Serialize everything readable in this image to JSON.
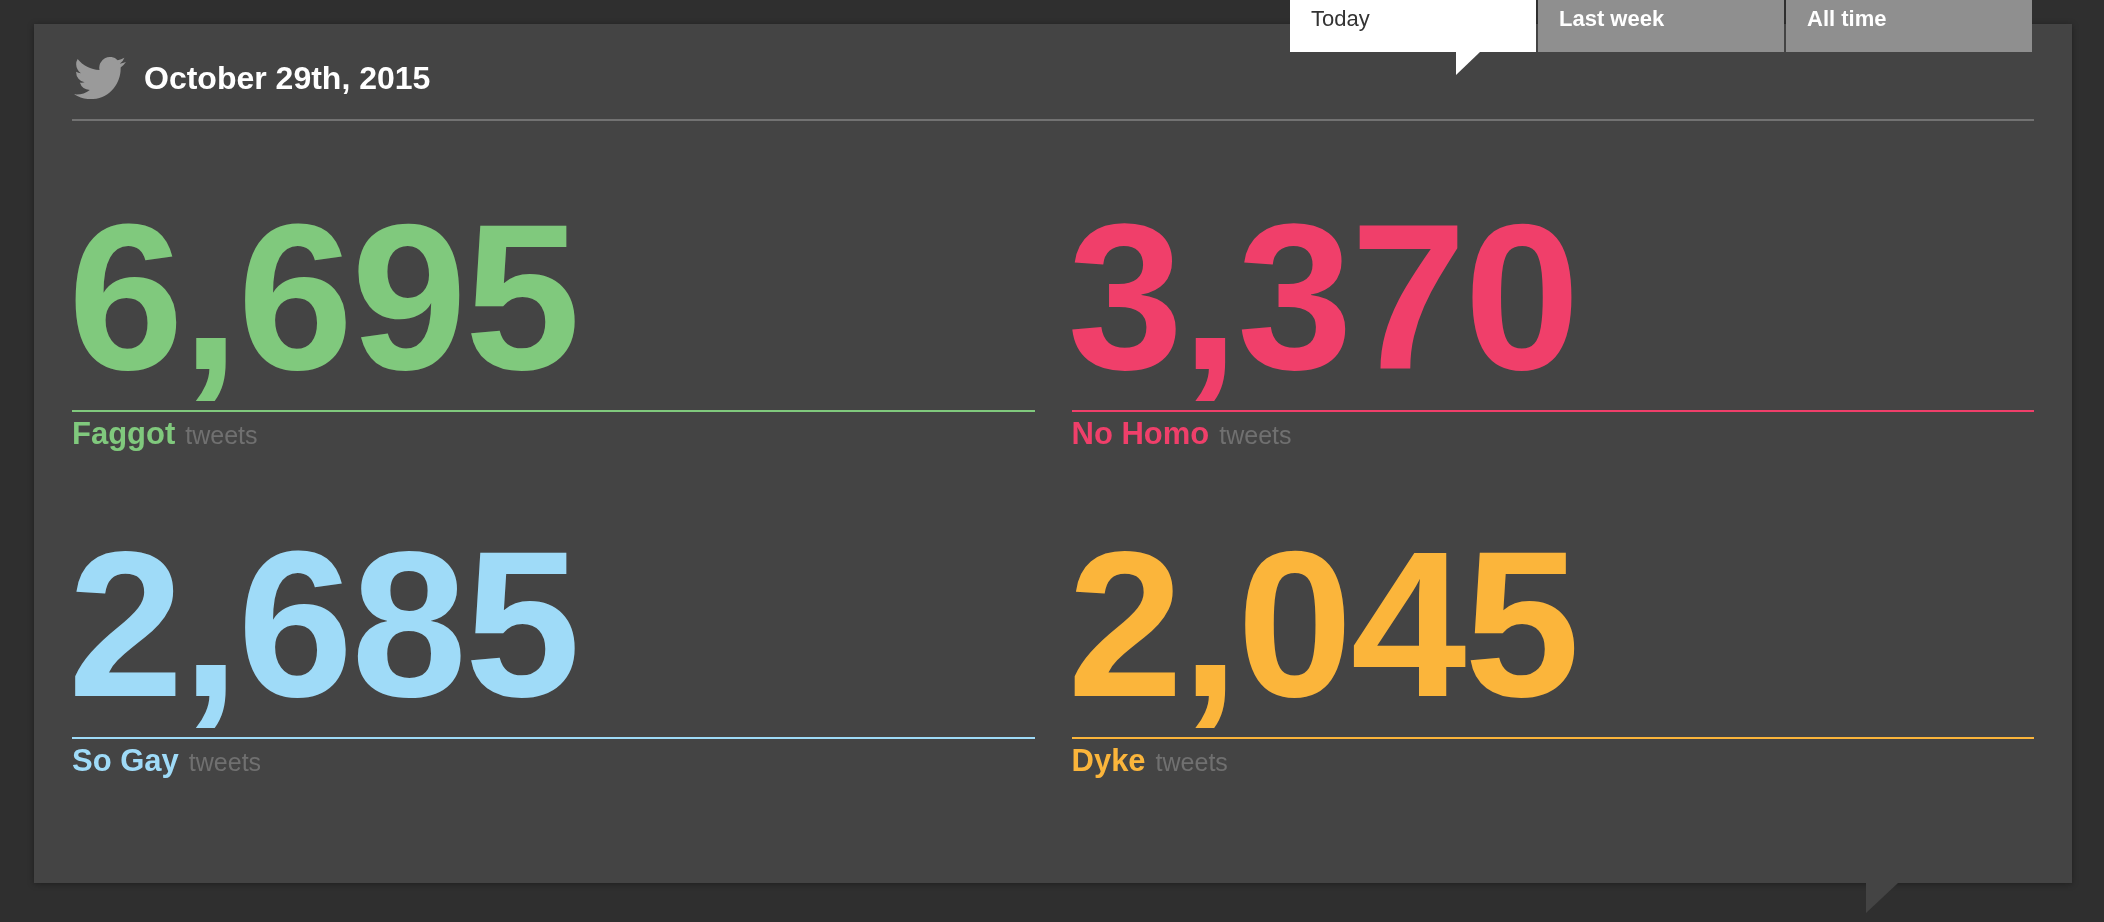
{
  "header": {
    "title": "October 29th, 2015"
  },
  "tabs": [
    {
      "label": "Today",
      "selected": true
    },
    {
      "label": "Last week",
      "selected": false
    },
    {
      "label": "All time",
      "selected": false
    }
  ],
  "stats": [
    {
      "count": "6,695",
      "term": "Faggot",
      "unit": "tweets",
      "color": "#80c97d"
    },
    {
      "count": "3,370",
      "term": "No Homo",
      "unit": "tweets",
      "color": "#f03f6a"
    },
    {
      "count": "2,685",
      "term": "So Gay",
      "unit": "tweets",
      "color": "#9fdbf8"
    },
    {
      "count": "2,045",
      "term": "Dyke",
      "unit": "tweets",
      "color": "#fbb53b"
    }
  ]
}
